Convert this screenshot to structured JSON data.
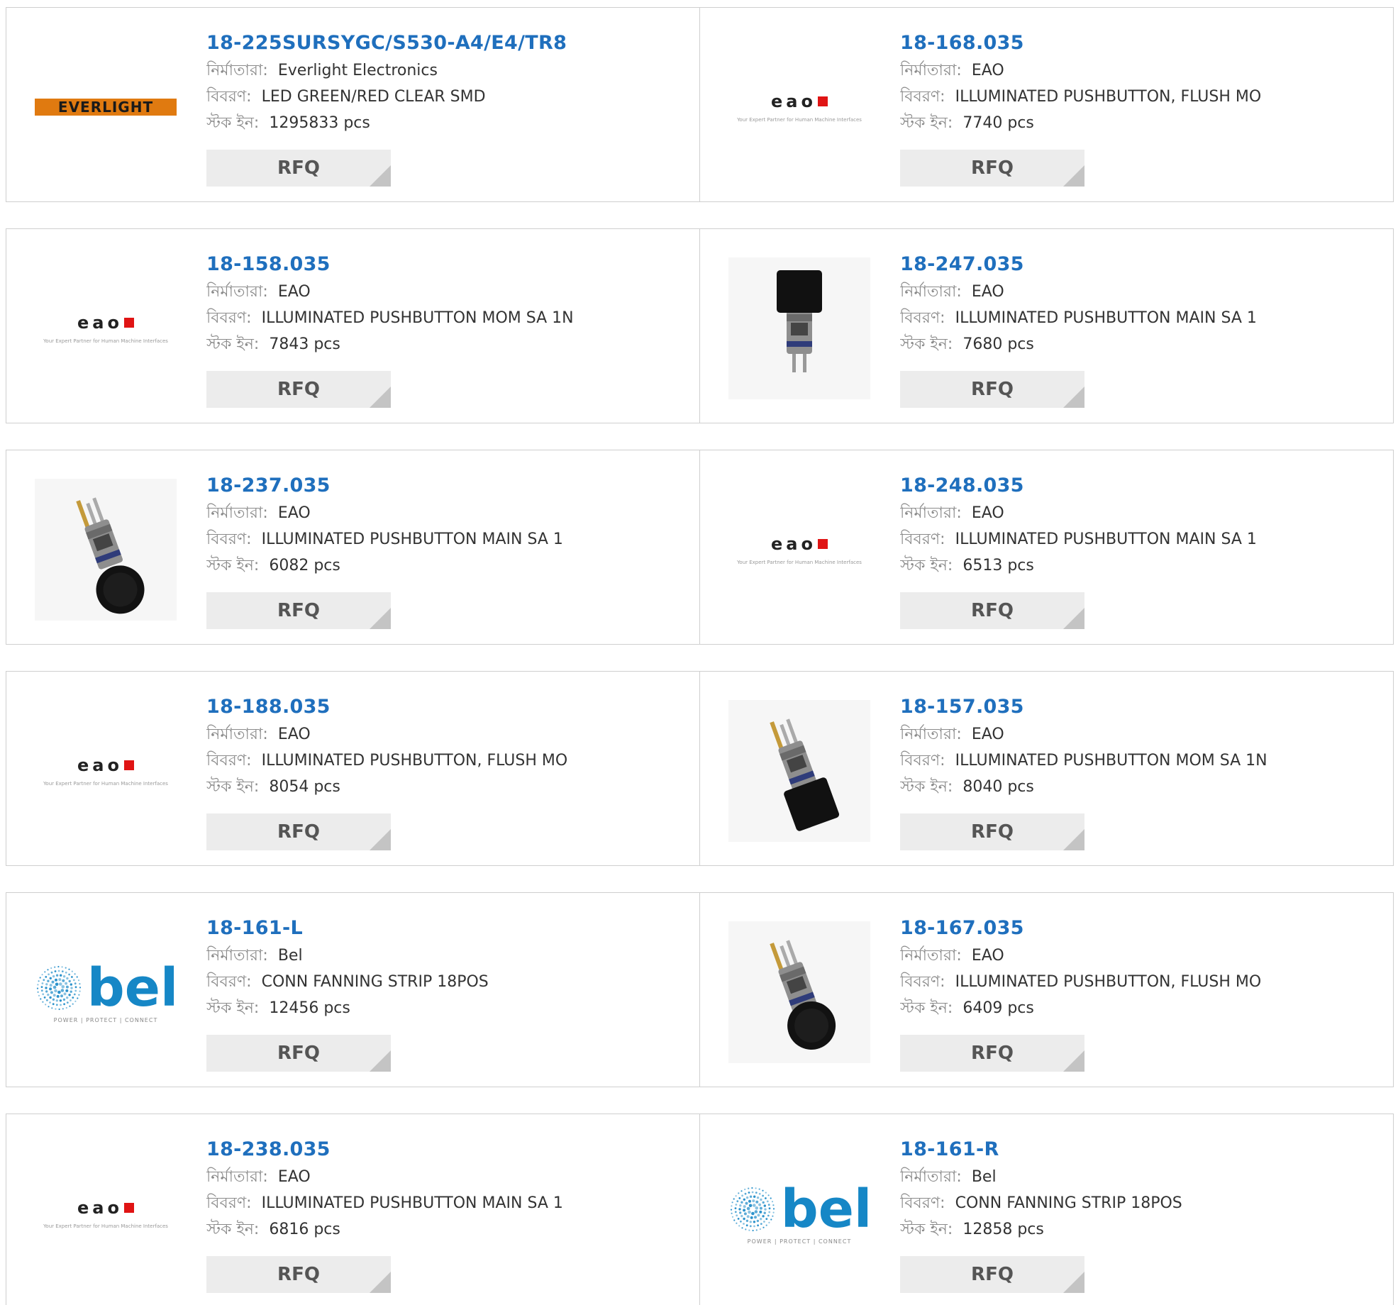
{
  "labels": {
    "manufacturer": "নির্মাতারা:",
    "description": "বিবরণ:",
    "stock": "স্টক ইন:",
    "rfq": "RFQ"
  },
  "rows": [
    [
      {
        "part": "18-225SURSYGC/S530-A4/E4/TR8",
        "manufacturer": "Everlight Electronics",
        "description": "LED GREEN/RED CLEAR SMD",
        "stock": "1295833 pcs",
        "image": "everlight-logo"
      },
      {
        "part": "18-168.035",
        "manufacturer": "EAO",
        "description": "ILLUMINATED PUSHBUTTON, FLUSH MO",
        "stock": "7740 pcs",
        "image": "eao-logo"
      }
    ],
    [
      {
        "part": "18-158.035",
        "manufacturer": "EAO",
        "description": "ILLUMINATED PUSHBUTTON MOM SA 1N",
        "stock": "7843 pcs",
        "image": "eao-logo"
      },
      {
        "part": "18-247.035",
        "manufacturer": "EAO",
        "description": "ILLUMINATED PUSHBUTTON MAIN SA 1",
        "stock": "7680 pcs",
        "image": "pushbutton-square-photo"
      }
    ],
    [
      {
        "part": "18-237.035",
        "manufacturer": "EAO",
        "description": "ILLUMINATED PUSHBUTTON MAIN SA 1",
        "stock": "6082 pcs",
        "image": "pushbutton-round-photo"
      },
      {
        "part": "18-248.035",
        "manufacturer": "EAO",
        "description": "ILLUMINATED PUSHBUTTON MAIN SA 1",
        "stock": "6513 pcs",
        "image": "eao-logo"
      }
    ],
    [
      {
        "part": "18-188.035",
        "manufacturer": "EAO",
        "description": "ILLUMINATED PUSHBUTTON, FLUSH MO",
        "stock": "8054 pcs",
        "image": "eao-logo"
      },
      {
        "part": "18-157.035",
        "manufacturer": "EAO",
        "description": "ILLUMINATED PUSHBUTTON MOM SA 1N",
        "stock": "8040 pcs",
        "image": "pushbutton-square-tilted-photo"
      }
    ],
    [
      {
        "part": "18-161-L",
        "manufacturer": "Bel",
        "description": "CONN FANNING STRIP 18POS",
        "stock": "12456 pcs",
        "image": "bel-logo"
      },
      {
        "part": "18-167.035",
        "manufacturer": "EAO",
        "description": "ILLUMINATED PUSHBUTTON, FLUSH MO",
        "stock": "6409 pcs",
        "image": "pushbutton-round-tilted-photo"
      }
    ],
    [
      {
        "part": "18-238.035",
        "manufacturer": "EAO",
        "description": "ILLUMINATED PUSHBUTTON MAIN SA 1",
        "stock": "6816 pcs",
        "image": "eao-logo"
      },
      {
        "part": "18-161-R",
        "manufacturer": "Bel",
        "description": "CONN FANNING STRIP 18POS",
        "stock": "12858 pcs",
        "image": "bel-logo"
      }
    ]
  ],
  "logos": {
    "everlight": "EVERLIGHT",
    "eao_mark": "eao",
    "eao_tagline": "Your Expert Partner for Human Machine Interfaces",
    "bel_word": "bel",
    "bel_tagline": "POWER | PROTECT | CONNECT"
  },
  "colors": {
    "part_link": "#1f6fbd",
    "label": "#8a8a8a",
    "rfq_bg": "#ececec",
    "border": "#cfcfcf",
    "eao_red": "#e01414",
    "bel_blue": "#1687c6",
    "everlight_orange": "#e07a10"
  }
}
